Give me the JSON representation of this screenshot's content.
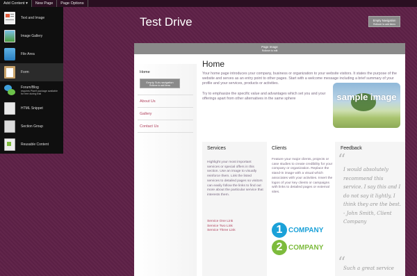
{
  "toolbar": {
    "add_content": "Add Content ▾",
    "new_page": "New Page",
    "page_options": "Page Options"
  },
  "panel": {
    "items": [
      {
        "label": "Text and Image",
        "icon": "text-image-icon"
      },
      {
        "label": "Image Gallery",
        "icon": "gallery-icon"
      },
      {
        "label": "File Area",
        "icon": "folder-icon"
      },
      {
        "label": "Form",
        "icon": "clipboard-icon"
      },
      {
        "label": "Forum/Blog",
        "sub": "requires Plan9 package available for free during trial",
        "icon": "chat-bubbles-icon"
      },
      {
        "label": "HTML Snippet",
        "icon": "html-snippet-icon"
      },
      {
        "label": "Section Group",
        "icon": "section-group-icon"
      },
      {
        "label": "Reusable Content",
        "icon": "reusable-content-icon"
      }
    ]
  },
  "site": {
    "title": "Test Drive",
    "empty_nav": "Empty Navigation",
    "empty_nav_hint": "Rollover to add items"
  },
  "page": {
    "image_label": "Page Image",
    "image_hint": "Rollover to edit"
  },
  "leftnav": {
    "home": "Home",
    "subnav": "Empty Sub-navigation",
    "subnav_hint": "Rollover to add items",
    "about": "About Us",
    "gallery": "Gallery",
    "contact": "Contact Us"
  },
  "main": {
    "title": "Home",
    "para1": "Your home page introduces your company, business or organization to your website visitors. It states the purpose of the website and serves as an entry point to other pages. Start with a welcome message including a brief summary of your profile and your services, products or activities.",
    "para2": "Try to emphasize the specific value and advantages which set you and your offerings apart from other alternatives in the same sphere",
    "sample_image": "sample image"
  },
  "services": {
    "title": "Services",
    "body": "Highlight your most important services or special offers in this section. Use an image to visually reinforce them. Link the listed services to detailed pages so visitors can easily follow the links to find out more about the particular service that interests them.",
    "links": [
      "Service One Link",
      "Service Two Link",
      "Service Three Link"
    ]
  },
  "clients": {
    "title": "Clients",
    "body": "Feature your major clients, projects or case studies to create credibility for your company or organization. Replace the stand-in image with a visual which associates with your activities. Insert the logos of your key clients or campaigns with links to detailed pages or external sites.",
    "logo1_num": "1",
    "logo1_name": "COMPANY",
    "logo2_num": "2",
    "logo2_name": "COMPANY",
    "colors": {
      "blue": "#1ba1d8",
      "green": "#7dbb3c"
    }
  },
  "feedback": {
    "title": "Feedback",
    "quote1": "I would absolutely recommend this service. I say this and I do not say it lightly, I think they are the best. - John Smith, Client Company",
    "quote2": "Such a great service"
  }
}
